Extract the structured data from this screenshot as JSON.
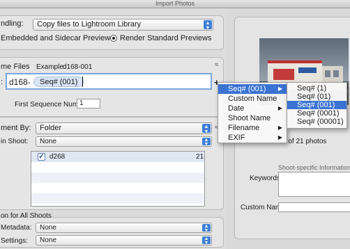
{
  "window": {
    "title": "Import Photos"
  },
  "handling": {
    "label": "ndling:",
    "value": "Copy files to Lightroom Library",
    "preview_embedded": "Embedded and Sidecar Previews",
    "preview_render": "Render Standard Previews",
    "selected_preview": "render"
  },
  "file_naming": {
    "title": "me Files",
    "example_label": "Example:",
    "example_value": "d168-001",
    "template_prefix_label": ":",
    "template_text": "d168-",
    "token_label": "Seq# (001)",
    "add_button": "+",
    "first_seq_label": "First Sequence Number:",
    "first_seq_value": "1"
  },
  "organize": {
    "label": "ment By:",
    "value": "Folder",
    "within_label": "in Shoot:",
    "within_value": "None",
    "folders": [
      {
        "name": "d268",
        "count": "21",
        "checked": true
      }
    ]
  },
  "all_shoots": {
    "title": "on for All Shoots",
    "metadata_label": "Metadata:",
    "metadata_value": "None",
    "settings_label": "Settings:",
    "settings_value": "None"
  },
  "token_menu": {
    "items": [
      {
        "label": "Seq# (001)",
        "has_sub": true,
        "selected": true
      },
      {
        "label": "Custom Name",
        "has_sub": false,
        "selected": false
      },
      {
        "label": "Date",
        "has_sub": true,
        "selected": false
      },
      {
        "label": "Shoot Name",
        "has_sub": false,
        "selected": false
      },
      {
        "label": "Filename",
        "has_sub": true,
        "selected": false
      },
      {
        "label": "EXIF",
        "has_sub": true,
        "selected": false
      }
    ]
  },
  "seq_submenu": {
    "items": [
      {
        "label": "Seq# (1)",
        "selected": false
      },
      {
        "label": "Seq# (01)",
        "selected": false
      },
      {
        "label": "Seq# (001)",
        "selected": true
      },
      {
        "label": "Seq# (0001)",
        "selected": false
      },
      {
        "label": "Seq# (00001)",
        "selected": false
      }
    ]
  },
  "preview": {
    "count_text": "1 of 21 photos",
    "shoot_info_title": "Shoot-specific Information",
    "keywords_label": "Keywords:",
    "custom_name_label": "Custom Name:"
  },
  "colors": {
    "accent": "#3a73d2",
    "popup_arrow": "#3f7fd6",
    "panel": "#e5e5e5"
  },
  "icons": {
    "popup_arrows": "up-down-arrows-icon",
    "collapse": "collapse-chevron-icon",
    "checkbox": "checkbox-checked-icon",
    "submenu": "submenu-arrow-icon"
  }
}
